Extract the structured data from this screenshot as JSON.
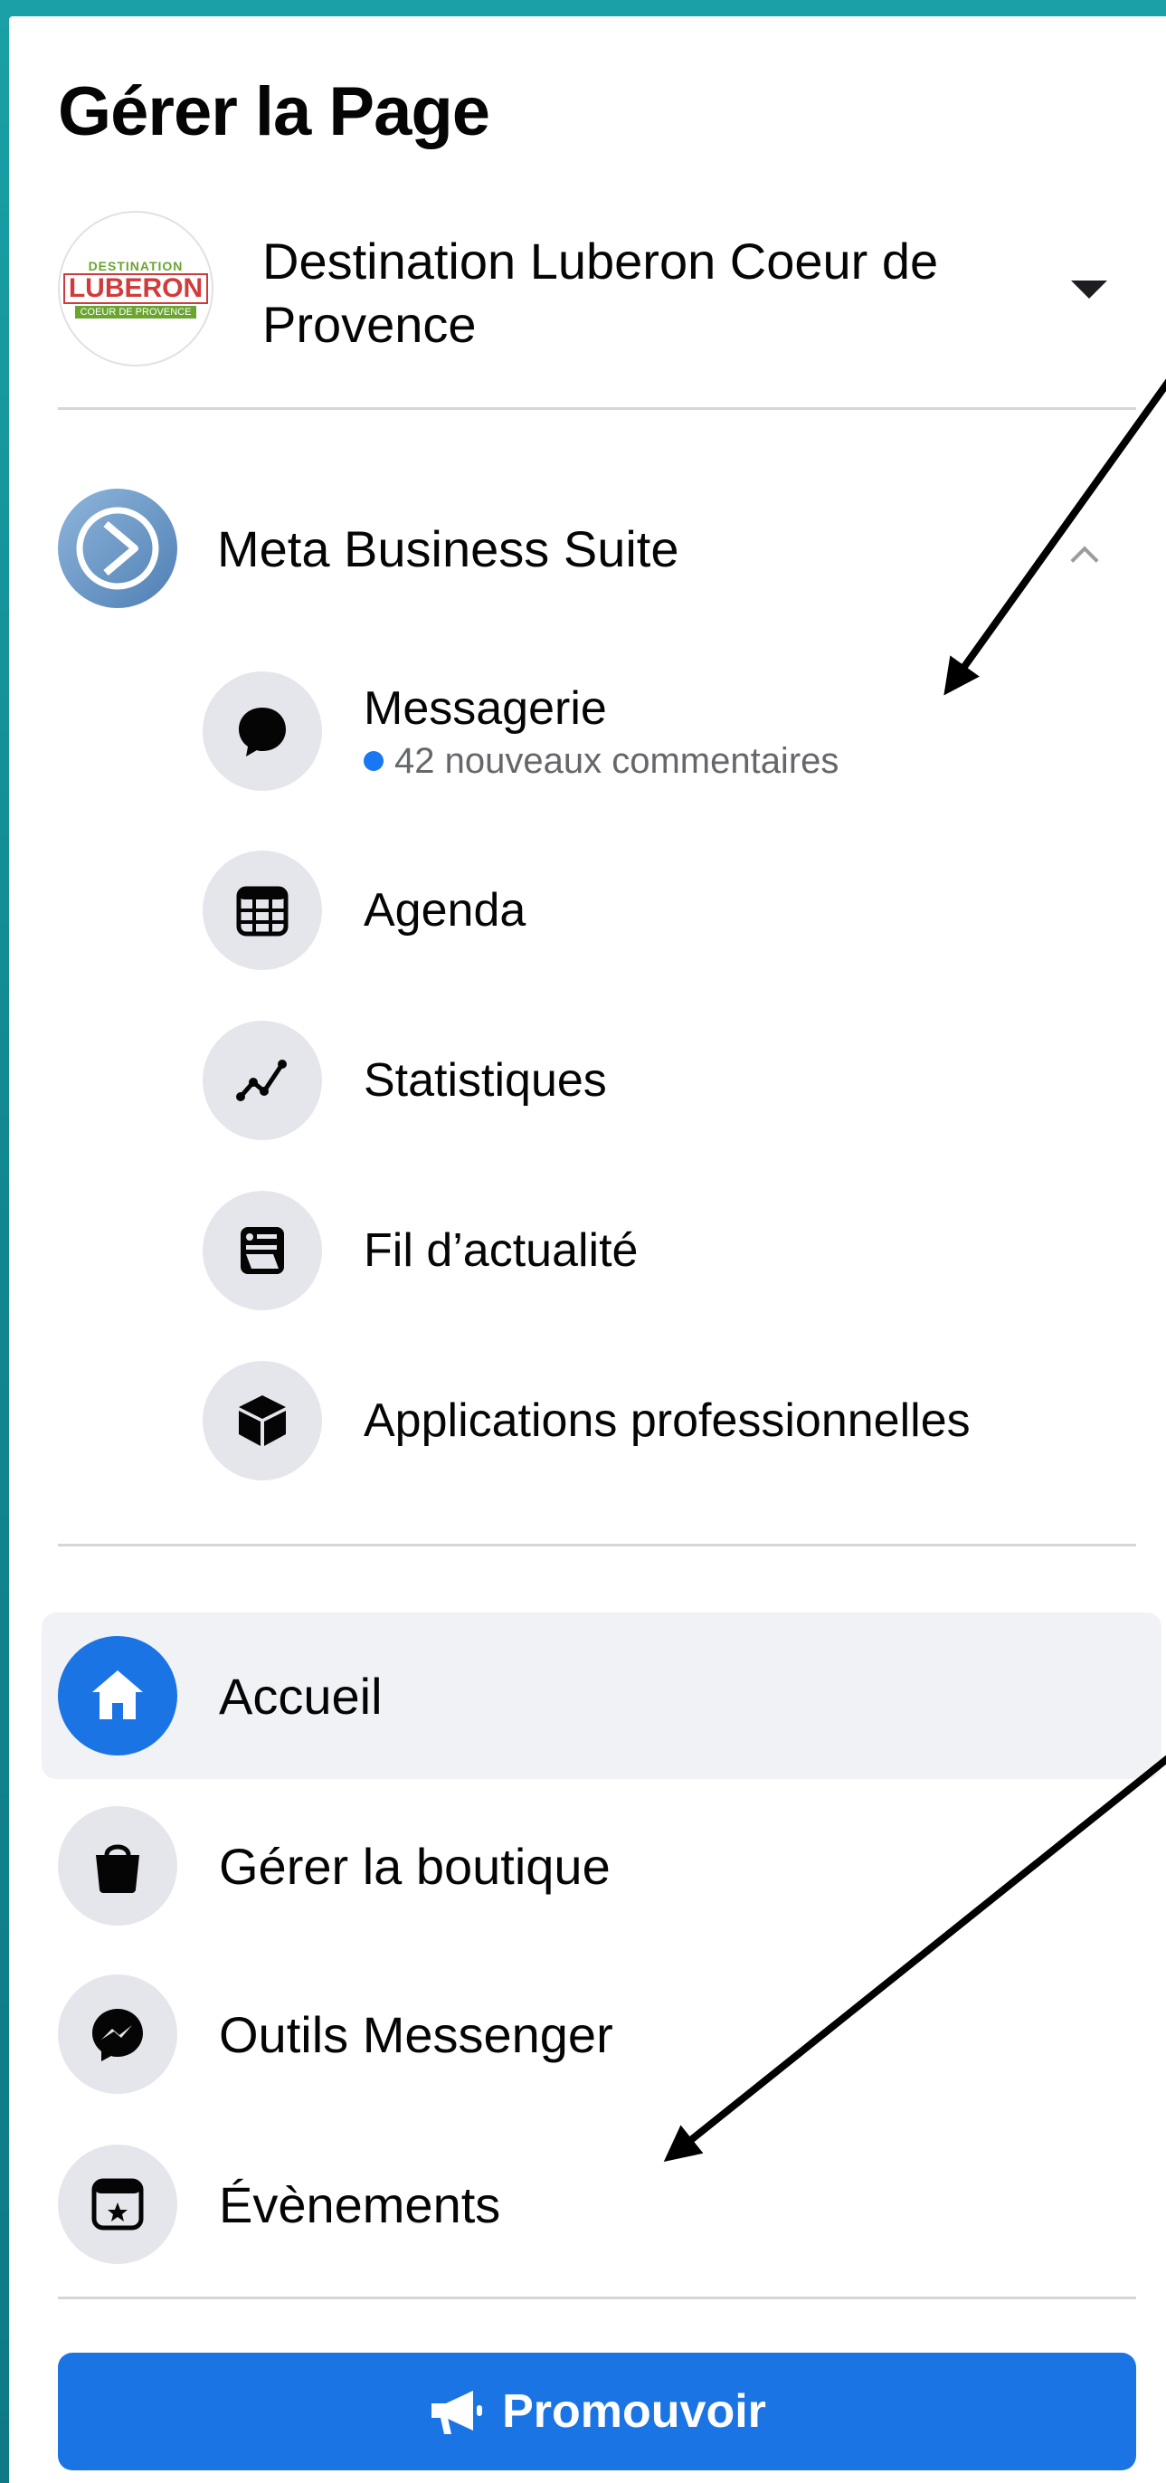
{
  "header": {
    "title": "Gérer la Page"
  },
  "page_selector": {
    "name": "Destination Luberon Coeur de Provence",
    "logo": {
      "top": "DESTINATION",
      "main": "LUBERON",
      "bottom": "COEUR DE PROVENCE"
    }
  },
  "business_suite": {
    "label": "Meta Business Suite",
    "items": [
      {
        "label": "Messagerie",
        "status": "42 nouveaux commentaires"
      },
      {
        "label": "Agenda"
      },
      {
        "label": "Statistiques"
      },
      {
        "label": "Fil d’actualité"
      },
      {
        "label": "Applications professionnelles"
      }
    ]
  },
  "nav": {
    "items": [
      {
        "label": "Accueil",
        "active": true
      },
      {
        "label": "Gérer la boutique"
      },
      {
        "label": "Outils Messenger"
      },
      {
        "label": "Évènements"
      }
    ]
  },
  "promote": {
    "label": "Promouvoir"
  },
  "colors": {
    "accent": "#1b74e4",
    "background": "#1aa0a6",
    "status_dot": "#1877f2"
  }
}
